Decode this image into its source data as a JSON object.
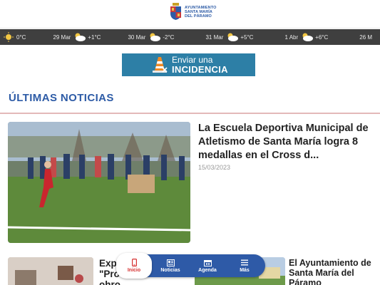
{
  "header": {
    "logo_line1": "AYUNTAMIENTO",
    "logo_line2": "SANTA MARÍA",
    "logo_line3": "DEL PÁRAMO"
  },
  "weather": [
    {
      "icon": "sun-icon",
      "temp": "0°C"
    },
    {
      "date": "29 Mar",
      "icon": "partly-cloudy-icon",
      "temp": "+1°C"
    },
    {
      "date": "30 Mar",
      "icon": "partly-cloudy-icon",
      "temp": "-2°C"
    },
    {
      "date": "31 Mar",
      "icon": "partly-cloudy-icon",
      "temp": "+5°C"
    },
    {
      "date": "1 Abr",
      "icon": "partly-cloudy-icon",
      "temp": "+6°C"
    },
    {
      "date": "26 M"
    }
  ],
  "incidencia": {
    "line1": "Enviar una",
    "line2": "INCIDENCIA",
    "icon": "traffic-cone-icon"
  },
  "section": {
    "title": "ÚLTIMAS NOTICIAS"
  },
  "news": [
    {
      "title": "La Escuela Deportiva Municipal de Atletismo de Santa María logra 8 medallas en el Cross d...",
      "date": "15/03/2023"
    },
    {
      "title_line1": "Exp",
      "title_line2": "\"Pro",
      "title_line3": "ohro"
    },
    {
      "title": "El Ayuntamiento de Santa María del Páramo"
    }
  ],
  "nav": [
    {
      "label": "Inicio",
      "icon": "phone-icon",
      "active": true
    },
    {
      "label": "Noticias",
      "icon": "newspaper-icon"
    },
    {
      "label": "Agenda",
      "icon": "calendar-icon"
    },
    {
      "label": "Más",
      "icon": "menu-icon"
    }
  ],
  "colors": {
    "brand_blue": "#2d5ba6",
    "weather_bg": "#3f3f3f",
    "incidencia_bg": "#2d7fa6",
    "nav_active": "#d63131"
  }
}
